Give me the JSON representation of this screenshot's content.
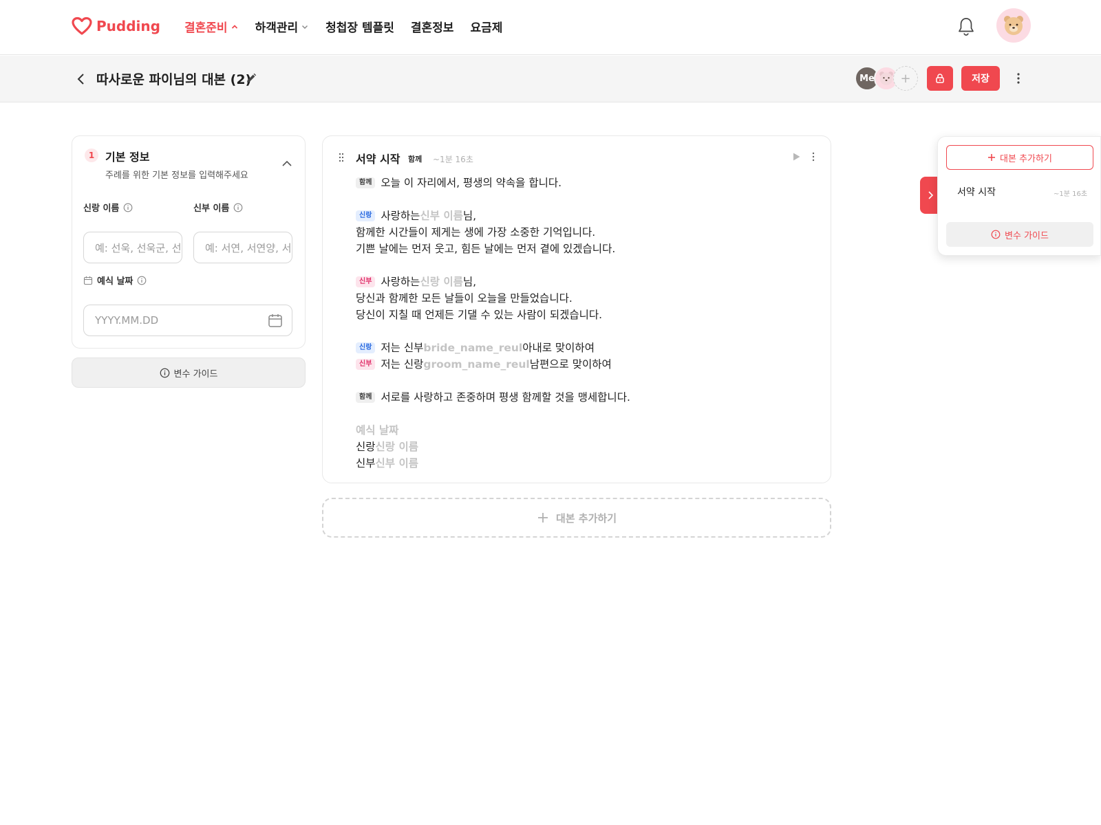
{
  "brand": {
    "name": "Pudding",
    "accent": "#f0484f"
  },
  "nav": {
    "items": [
      {
        "label": "결혼준비",
        "active": true,
        "chevron": "up"
      },
      {
        "label": "하객관리",
        "active": false,
        "chevron": "down"
      },
      {
        "label": "청첩장 템플릿",
        "active": false
      },
      {
        "label": "결혼정보",
        "active": false
      },
      {
        "label": "요금제",
        "active": false
      }
    ]
  },
  "subheader": {
    "title": "따사로운 파이님의 대본 (2)",
    "me_label": "Me",
    "add_collab": "+",
    "save_label": "저장"
  },
  "basic_info": {
    "step": "1",
    "title": "기본 정보",
    "description": "주례를 위한 기본 정보를 입력해주세요",
    "groom_label": "신랑 이름",
    "groom_placeholder": "예: 선욱, 선욱군, 선욱",
    "bride_label": "신부 이름",
    "bride_placeholder": "예: 서연, 서연양, 서연",
    "date_label": "예식 날짜",
    "date_placeholder": "YYYY.MM.DD",
    "guide_label": "변수 가이드"
  },
  "script": {
    "title": "서약 시작",
    "title_tag": "함께",
    "duration": "~1분 16초",
    "tags": {
      "together": "함께",
      "groom": "신랑",
      "bride": "신부"
    },
    "l1": "오늘 이 자리에서, 평생의 약속을 합니다.",
    "l2a": "사랑하는 ",
    "l2v": "신부 이름",
    "l2b": "님,",
    "l3": "함께한 시간들이 제게는 생에 가장 소중한 기억입니다.",
    "l4": "기쁜 날에는 먼저 웃고, 힘든 날에는 먼저 곁에 있겠습니다.",
    "l5a": "사랑하는 ",
    "l5v": "신랑 이름",
    "l5b": "님,",
    "l6": "당신과 함께한 모든 날들이 오늘을 만들었습니다.",
    "l7": "당신이 지칠 때 언제든 기댈 수 있는 사람이 되겠습니다.",
    "l8a": "저는 신부 ",
    "l8v": "bride_name_reul",
    "l8b": " 아내로 맞이하여",
    "l9a": "저는 신랑 ",
    "l9v": "groom_name_reul",
    "l9b": " 남편으로 맞이하여",
    "l10": "서로를 사랑하고 존중하며 평생 함께할 것을 맹세합니다.",
    "l11v": "예식 날짜",
    "l12a": "신랑 ",
    "l12v": "신랑 이름",
    "l13a": "신부 ",
    "l13v": "신부 이름",
    "add_label": "대본 추가하기"
  },
  "right_panel": {
    "add_label": "대본 추가하기",
    "item_title": "서약 시작",
    "item_duration": "~1분 16초",
    "guide_label": "변수 가이드"
  }
}
